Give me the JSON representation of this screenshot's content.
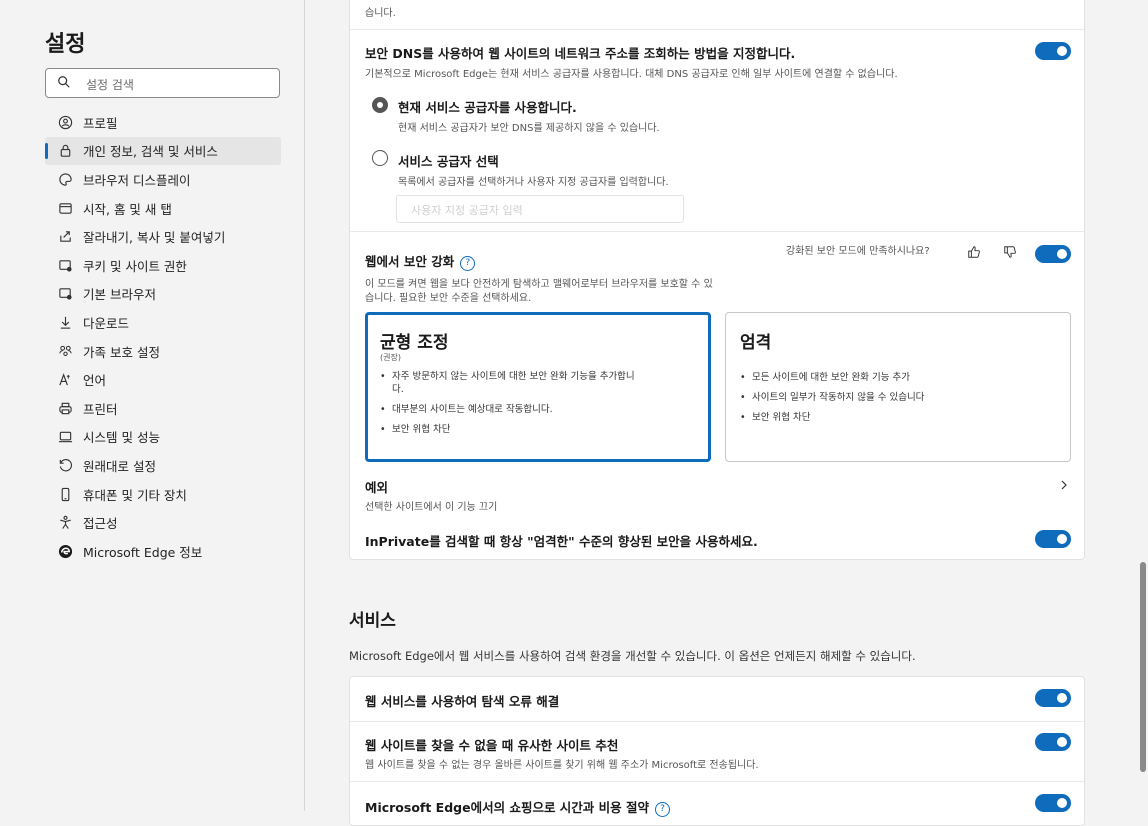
{
  "sidebar": {
    "title": "설정",
    "search_placeholder": "설정 검색",
    "items": [
      {
        "label": "프로필",
        "icon": "profile-icon"
      },
      {
        "label": "개인 정보, 검색 및 서비스",
        "icon": "lock-icon",
        "active": true
      },
      {
        "label": "브라우저 디스플레이",
        "icon": "appearance-icon"
      },
      {
        "label": "시작, 홈 및 새 탭",
        "icon": "start-page-icon"
      },
      {
        "label": "잘라내기, 복사 및 붙여넣기",
        "icon": "share-icon"
      },
      {
        "label": "쿠키 및 사이트 권한",
        "icon": "cookie-permissions-icon"
      },
      {
        "label": "기본 브라우저",
        "icon": "default-browser-icon"
      },
      {
        "label": "다운로드",
        "icon": "download-icon"
      },
      {
        "label": "가족 보호 설정",
        "icon": "family-icon"
      },
      {
        "label": "언어",
        "icon": "language-icon"
      },
      {
        "label": "프린터",
        "icon": "printer-icon"
      },
      {
        "label": "시스템 및 성능",
        "icon": "system-icon"
      },
      {
        "label": "원래대로 설정",
        "icon": "reset-icon"
      },
      {
        "label": "휴대폰 및 기타 장치",
        "icon": "phone-icon"
      },
      {
        "label": "접근성",
        "icon": "accessibility-icon"
      },
      {
        "label": "Microsoft Edge 정보",
        "icon": "edge-logo-icon"
      }
    ]
  },
  "security": {
    "top_cut_text": "습니다.",
    "dns": {
      "title": "보안 DNS를 사용하여 웹 사이트의 네트워크 주소를 조회하는 방법을 지정합니다.",
      "subtitle": "기본적으로 Microsoft Edge는 현재 서비스 공급자를 사용합니다. 대체 DNS 공급자로 인해 일부 사이트에 연결할 수 없습니다.",
      "option1_title": "현재 서비스 공급자를 사용합니다.",
      "option1_sub": "현재 서비스 공급자가 보안 DNS를 제공하지 않을 수 있습니다.",
      "option2_title": "서비스 공급자 선택",
      "option2_sub": "목록에서 공급자를 선택하거나 사용자 지정 공급자를 입력합니다.",
      "input_placeholder": "사용자 지정 공급자 입력"
    },
    "enhance": {
      "title": "웹에서 보안 강화",
      "desc_line1": "이 모드를 켜면 웹을 보다 안전하게 탐색하고 맬웨어로부터 브라우저를 보호할 수 있",
      "desc_line2": "습니다. 필요한 보안 수준을 선택하세요.",
      "feedback": "강화된 보안 모드에 만족하시나요?",
      "balanced": {
        "title": "균형 조정",
        "recommended": "(권장)",
        "b1a": "자주 방문하지 않는 사이트에 대한 보안 완화 기능을 추가합니",
        "b1b": "다.",
        "b2": "대부분의 사이트는 예상대로 작동합니다.",
        "b3": "보안 위협 차단"
      },
      "strict": {
        "title": "엄격",
        "b1": "모든 사이트에 대한 보안 완화 기능 추가",
        "b2": "사이트의 일부가 작동하지 않을 수 있습니다",
        "b3": "보안 위협 차단"
      },
      "exceptions_title": "예외",
      "exceptions_sub": "선택한 사이트에서 이 기능 끄기",
      "inprivate": "InPrivate를 검색할 때 항상 \"엄격한\" 수준의 향상된 보안을 사용하세요."
    }
  },
  "services": {
    "heading": "서비스",
    "desc": "Microsoft Edge에서 웹 서비스를 사용하여 검색 환경을 개선할 수 있습니다. 이 옵션은 언제든지 해제할 수 있습니다.",
    "row1": "웹 서비스를 사용하여 탐색 오류 해결",
    "row2_title": "웹 사이트를 찾을 수 없을 때 유사한 사이트 추천",
    "row2_sub": "웹 사이트를 찾을 수 없는 경우 올바른 사이트를 찾기 위해 웹 주소가 Microsoft로 전송됩니다.",
    "row3": "Microsoft Edge에서의 쇼핑으로 시간과 비용 절약"
  },
  "colors": {
    "accent": "#0f6cbd"
  }
}
